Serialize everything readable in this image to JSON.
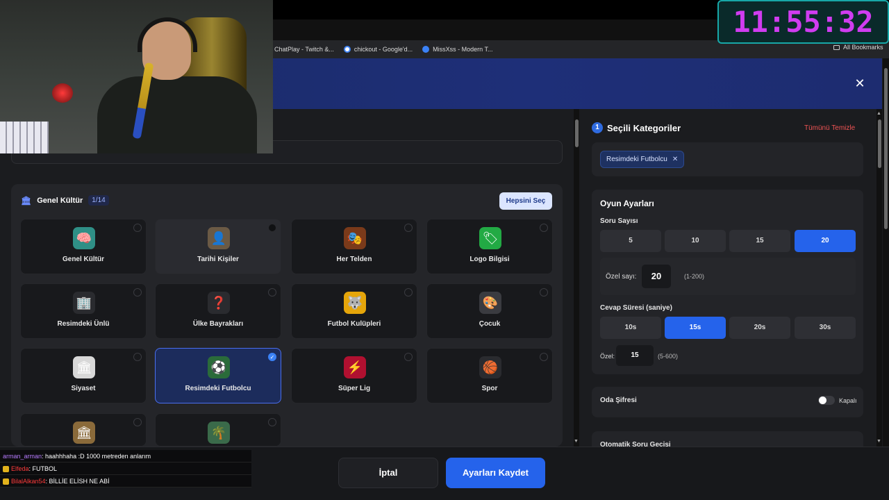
{
  "browser": {
    "bookmarks": [
      {
        "label": "ChatPlay - Twitch &...",
        "color": "#9146ff"
      },
      {
        "label": "chickout - Google'd...",
        "color": "#4285f4"
      },
      {
        "label": "MissXss - Modern T...",
        "color": "#3b82f6"
      }
    ],
    "all_bookmarks": "All Bookmarks"
  },
  "modal": {
    "close_icon": "close-icon"
  },
  "categories": {
    "title": "Genel Kültür",
    "count": "1/14",
    "select_all": "Hepsini Seç",
    "items": [
      {
        "label": "Genel Kültür",
        "icon": "🧠",
        "bg": "#2f8f86"
      },
      {
        "label": "Tarihi Kişiler",
        "icon": "👤",
        "bg": "#6b5a45"
      },
      {
        "label": "Her Telden",
        "icon": "🎭",
        "bg": "#7a3a1a"
      },
      {
        "label": "Logo Bilgisi",
        "icon": "🏷",
        "bg": "#22aa44"
      },
      {
        "label": "Resimdeki Ünlü",
        "icon": "🏢",
        "bg": "#2a2b2f"
      },
      {
        "label": "Ülke Bayrakları",
        "icon": "❓",
        "bg": "#2a2b2f"
      },
      {
        "label": "Futbol Kulüpleri",
        "icon": "🐺",
        "bg": "#e5a50a"
      },
      {
        "label": "Çocuk",
        "icon": "🎨",
        "bg": "#3a3b40"
      },
      {
        "label": "Siyaset",
        "icon": "🏛",
        "bg": "#d8d8d8"
      },
      {
        "label": "Resimdeki Futbolcu",
        "icon": "⚽",
        "bg": "#2a6b3a"
      },
      {
        "label": "Süper Lig",
        "icon": "⚡",
        "bg": "#b01030"
      },
      {
        "label": "Spor",
        "icon": "🏀",
        "bg": "#2a2b2f"
      },
      {
        "label": "",
        "icon": "🏛",
        "bg": "#8a6a3a"
      },
      {
        "label": "",
        "icon": "🌴",
        "bg": "#3a6a4a"
      }
    ]
  },
  "selected": {
    "step": "1",
    "title": "Seçili Kategoriler",
    "clear": "Tümünü Temizle",
    "chip": "Resimdeki Futbolcu"
  },
  "game_settings": {
    "title": "Oyun Ayarları",
    "question_count_label": "Soru Sayısı",
    "question_options": [
      "5",
      "10",
      "15",
      "20"
    ],
    "question_selected": "20",
    "custom_count_label": "Özel sayı:",
    "custom_count_value": "20",
    "custom_count_hint": "(1-200)",
    "answer_time_label": "Cevap Süresi (saniye)",
    "time_options": [
      "10s",
      "15s",
      "20s",
      "30s"
    ],
    "time_selected": "15s",
    "custom_time_label": "Özel:",
    "custom_time_value": "15",
    "custom_time_hint": "(5-600)"
  },
  "room_password": {
    "label": "Oda Şifresi",
    "state": "Kapalı"
  },
  "auto_next": {
    "label": "Otomatik Soru Geçişi"
  },
  "footer": {
    "cancel": "İptal",
    "save": "Ayarları Kaydet"
  },
  "overlay": {
    "clock": "11:55:32",
    "chat": [
      {
        "user": "arman_arman",
        "user_color": "#b77cff",
        "text": ": haahhhaha :D 1000 metreden anlarım",
        "badge": false
      },
      {
        "user": "Elfeda",
        "user_color": "#ff3b3b",
        "text": ": FUTBOL",
        "badge": true
      },
      {
        "user": "BilalAlkan54",
        "user_color": "#ff3b3b",
        "text": ": BİLLİE ELİSH NE ABİ",
        "badge": true
      }
    ]
  }
}
